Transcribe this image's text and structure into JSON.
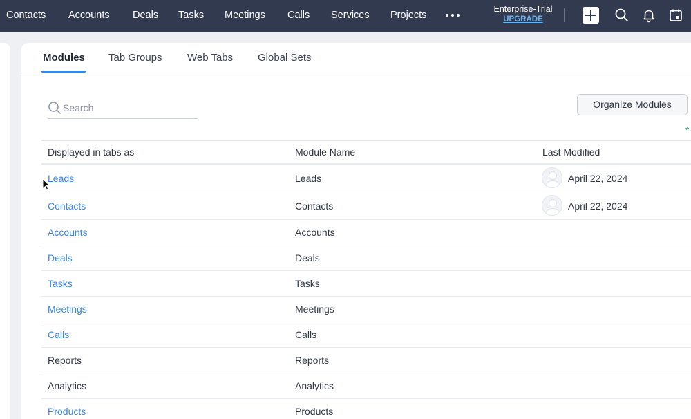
{
  "nav": {
    "items": [
      "Contacts",
      "Accounts",
      "Deals",
      "Tasks",
      "Meetings",
      "Calls",
      "Services",
      "Projects"
    ],
    "more_icon": "more-horizontal-icon",
    "edition": "Enterprise-Trial",
    "upgrade": "UPGRADE",
    "icons": [
      "add-icon",
      "search-icon",
      "bell-icon",
      "calendar-icon"
    ]
  },
  "tabs": [
    "Modules",
    "Tab Groups",
    "Web Tabs",
    "Global Sets"
  ],
  "active_tab": "Modules",
  "search": {
    "placeholder": "Search",
    "value": ""
  },
  "organize_button": "Organize Modules",
  "marker": "*",
  "table": {
    "headers": [
      "Displayed in tabs as",
      "Module Name",
      "Last Modified"
    ],
    "rows": [
      {
        "tab": "Leads",
        "module": "Leads",
        "modified": "April 22, 2024",
        "link": true
      },
      {
        "tab": "Contacts",
        "module": "Contacts",
        "modified": "April 22, 2024",
        "link": true
      },
      {
        "tab": "Accounts",
        "module": "Accounts",
        "modified": "",
        "link": true
      },
      {
        "tab": "Deals",
        "module": "Deals",
        "modified": "",
        "link": true
      },
      {
        "tab": "Tasks",
        "module": "Tasks",
        "modified": "",
        "link": true
      },
      {
        "tab": "Meetings",
        "module": "Meetings",
        "modified": "",
        "link": true
      },
      {
        "tab": "Calls",
        "module": "Calls",
        "modified": "",
        "link": true
      },
      {
        "tab": "Reports",
        "module": "Reports",
        "modified": "",
        "link": false
      },
      {
        "tab": "Analytics",
        "module": "Analytics",
        "modified": "",
        "link": false
      },
      {
        "tab": "Products",
        "module": "Products",
        "modified": "",
        "link": true
      }
    ]
  },
  "colors": {
    "nav_bg": "#313a4f",
    "link": "#3a87e0",
    "accent_tab": "#3a87e0",
    "upgrade": "#6cb4f0",
    "marker": "#2eb67d"
  }
}
